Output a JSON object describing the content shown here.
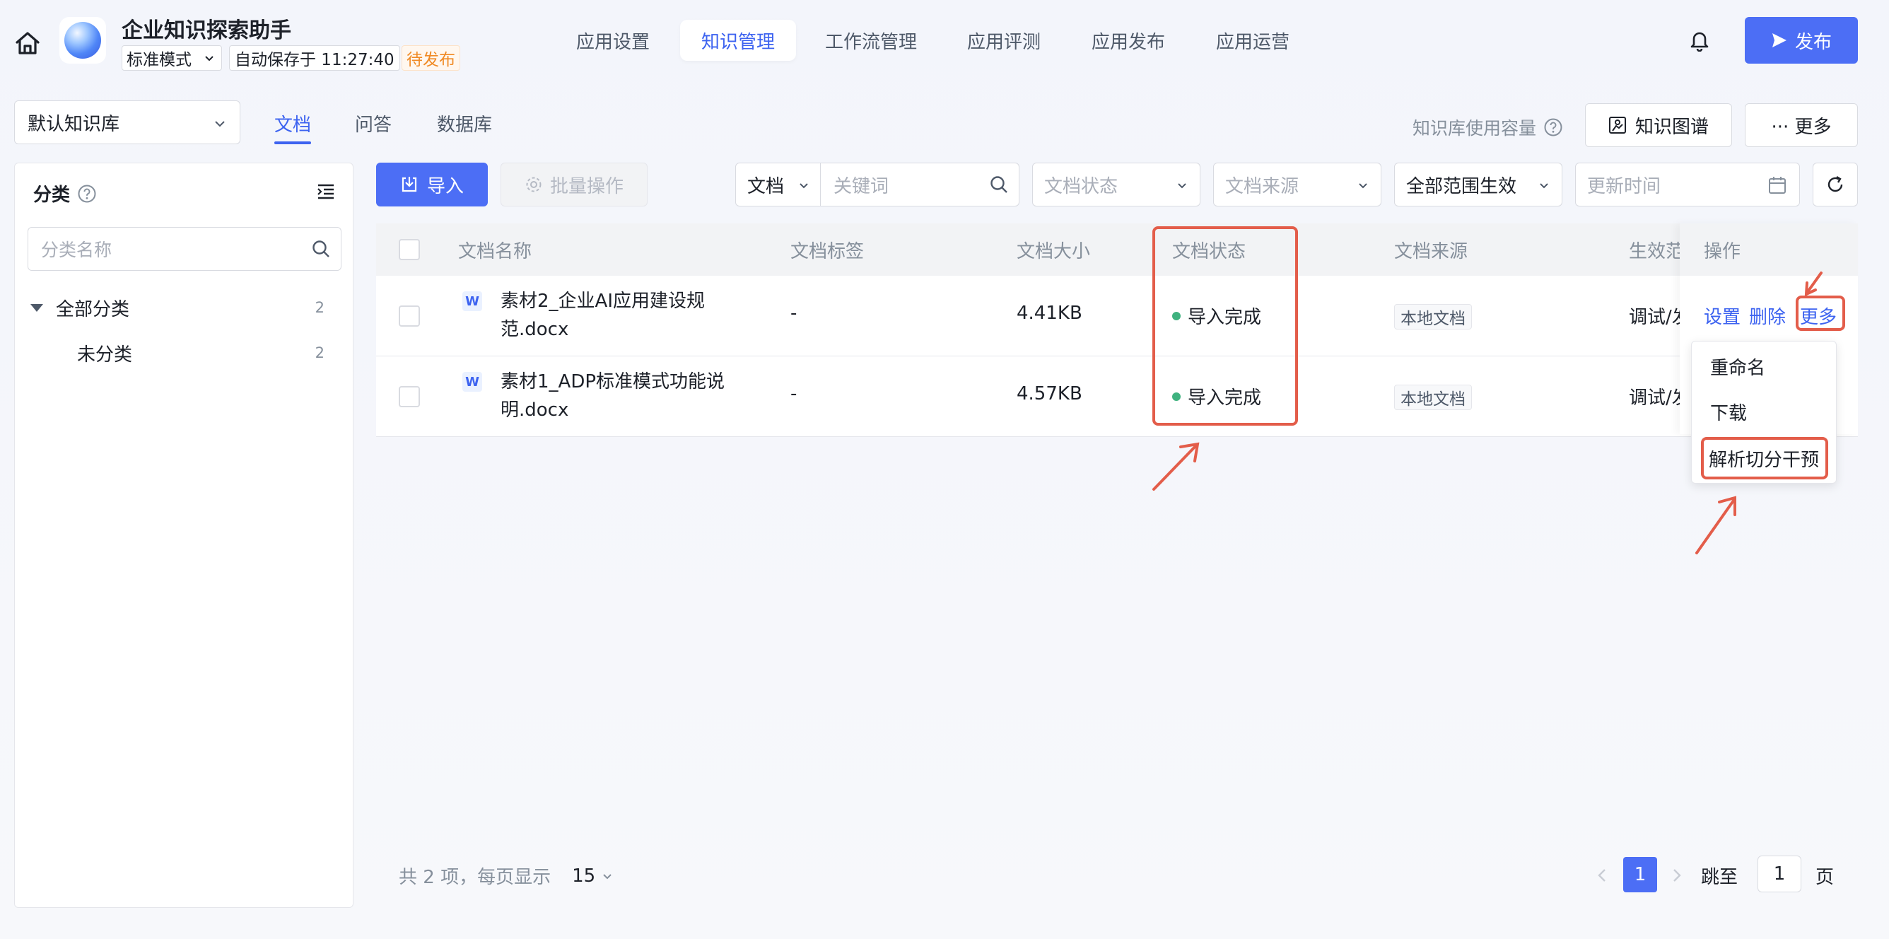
{
  "header": {
    "app_title": "企业知识探索助手",
    "mode": "标准模式",
    "save_status": "自动保存于 11:27:40",
    "draft_badge": "待发布",
    "nav": [
      "应用设置",
      "知识管理",
      "工作流管理",
      "应用评测",
      "应用发布",
      "应用运营"
    ],
    "active_nav": "知识管理",
    "publish_label": "发布"
  },
  "subheader": {
    "kb_select": "默认知识库",
    "tabs": [
      "文档",
      "问答",
      "数据库"
    ],
    "active_tab": "文档",
    "capacity_label": "知识库使用容量",
    "graph_label": "知识图谱",
    "more_label": "··· 更多"
  },
  "category": {
    "title": "分类",
    "search_placeholder": "分类名称",
    "items": [
      {
        "label": "全部分类",
        "count": "2"
      },
      {
        "label": "未分类",
        "count": "2"
      }
    ]
  },
  "toolbar": {
    "import_label": "导入",
    "batch_label": "批量操作",
    "search_type": "文档",
    "keyword_placeholder": "关键词",
    "status_placeholder": "文档状态",
    "source_placeholder": "文档来源",
    "scope_value": "全部范围生效",
    "time_placeholder": "更新时间"
  },
  "table": {
    "columns": [
      "文档名称",
      "文档标签",
      "文档大小",
      "文档状态",
      "文档来源",
      "生效范",
      "操作"
    ],
    "rows": [
      {
        "name": "素材2_企业AI应用建设规范.docx",
        "tag": "-",
        "size": "4.41KB",
        "status": "导入完成",
        "source": "本地文档",
        "scope": "调试/发"
      },
      {
        "name": "素材1_ADP标准模式功能说明.docx",
        "tag": "-",
        "size": "4.57KB",
        "status": "导入完成",
        "source": "本地文档",
        "scope": "调试/发"
      }
    ],
    "actions": [
      "设置",
      "删除",
      "更多"
    ]
  },
  "dropdown": {
    "items": [
      "重命名",
      "下载",
      "解析切分干预"
    ]
  },
  "pagination": {
    "total_text": "共 2 项，每页显示",
    "page_size": "15",
    "current_page": "1",
    "jump_label": "跳至",
    "jump_value": "1",
    "page_unit": "页"
  },
  "colors": {
    "primary": "#4c6ef5",
    "status_ok": "#3fb27f",
    "annotation": "#e35d4a",
    "draft": "#f08a24"
  }
}
